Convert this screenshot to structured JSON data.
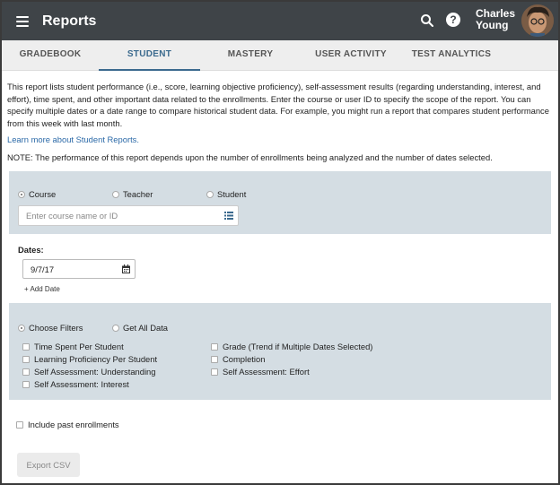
{
  "header": {
    "title": "Reports",
    "user_name": "Charles Young",
    "menu_icon": "hamburger-menu-icon",
    "search_icon": "search-icon",
    "help_icon": "help-icon",
    "help_glyph": "?"
  },
  "tabs": [
    {
      "label": "GRADEBOOK",
      "active": false
    },
    {
      "label": "STUDENT",
      "active": true
    },
    {
      "label": "MASTERY",
      "active": false
    },
    {
      "label": "USER ACTIVITY",
      "active": false
    },
    {
      "label": "TEST ANALYTICS",
      "active": false
    }
  ],
  "intro": "This report lists student performance (i.e., score, learning objective proficiency), self-assessment results (regarding understanding, interest, and effort), time spent, and other important data related to the enrollments. Enter the course or user ID to specify the scope of the report. You can specify multiple dates or a date range to compare historical student data. For example, you might run a report that compares student performance from this week with last month.",
  "learn_more": "Learn more about Student Reports.",
  "note": "NOTE: The performance of this report depends upon the number of enrollments being analyzed and the number of dates selected.",
  "scope": {
    "options": [
      {
        "label": "Course",
        "checked": true
      },
      {
        "label": "Teacher",
        "checked": false
      },
      {
        "label": "Student",
        "checked": false
      }
    ],
    "input_placeholder": "Enter course name or ID"
  },
  "dates": {
    "label": "Dates:",
    "value": "9/7/17",
    "add_label": "+ Add Date"
  },
  "filters": {
    "modes": [
      {
        "label": "Choose Filters",
        "checked": true
      },
      {
        "label": "Get All Data",
        "checked": false
      }
    ],
    "left": [
      "Time Spent Per Student",
      "Learning Proficiency Per Student",
      "Self Assessment: Understanding",
      "Self Assessment: Interest"
    ],
    "right": [
      "Grade (Trend if Multiple Dates Selected)",
      "Completion",
      "Self Assessment: Effort"
    ]
  },
  "include_past": "Include past enrollments",
  "export_label": "Export CSV",
  "colors": {
    "topbar": "#3f4448",
    "accent": "#3b6a8e",
    "panel": "#d4dde3",
    "link": "#2c6aa8"
  }
}
